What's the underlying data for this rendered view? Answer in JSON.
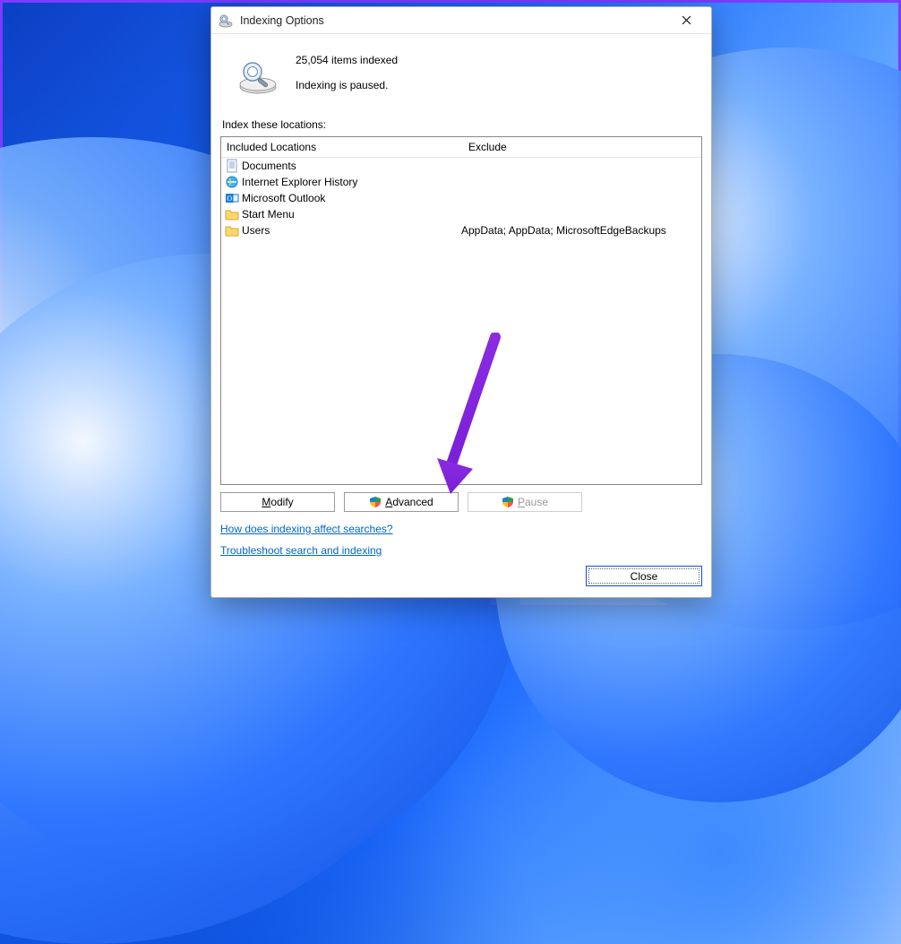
{
  "window": {
    "title": "Indexing Options"
  },
  "status": {
    "count_line": "25,054 items indexed",
    "state_line": "Indexing is paused."
  },
  "section_label": "Index these locations:",
  "columns": {
    "included": "Included Locations",
    "exclude": "Exclude"
  },
  "rows": [
    {
      "icon": "doc",
      "name": "Documents",
      "exclude": ""
    },
    {
      "icon": "ie",
      "name": "Internet Explorer History",
      "exclude": ""
    },
    {
      "icon": "outlook",
      "name": "Microsoft Outlook",
      "exclude": ""
    },
    {
      "icon": "folder",
      "name": "Start Menu",
      "exclude": ""
    },
    {
      "icon": "folder",
      "name": "Users",
      "exclude": "AppData; AppData; MicrosoftEdgeBackups"
    }
  ],
  "buttons": {
    "modify": {
      "label_pre": "",
      "label_hot": "M",
      "label_post": "odify"
    },
    "advanced": {
      "label_pre": "",
      "label_hot": "A",
      "label_post": "dvanced"
    },
    "pause": {
      "label_pre": "",
      "label_hot": "P",
      "label_post": "ause"
    },
    "close": "Close"
  },
  "links": {
    "how": "How does indexing affect searches?",
    "troubleshoot": "Troubleshoot search and indexing"
  }
}
